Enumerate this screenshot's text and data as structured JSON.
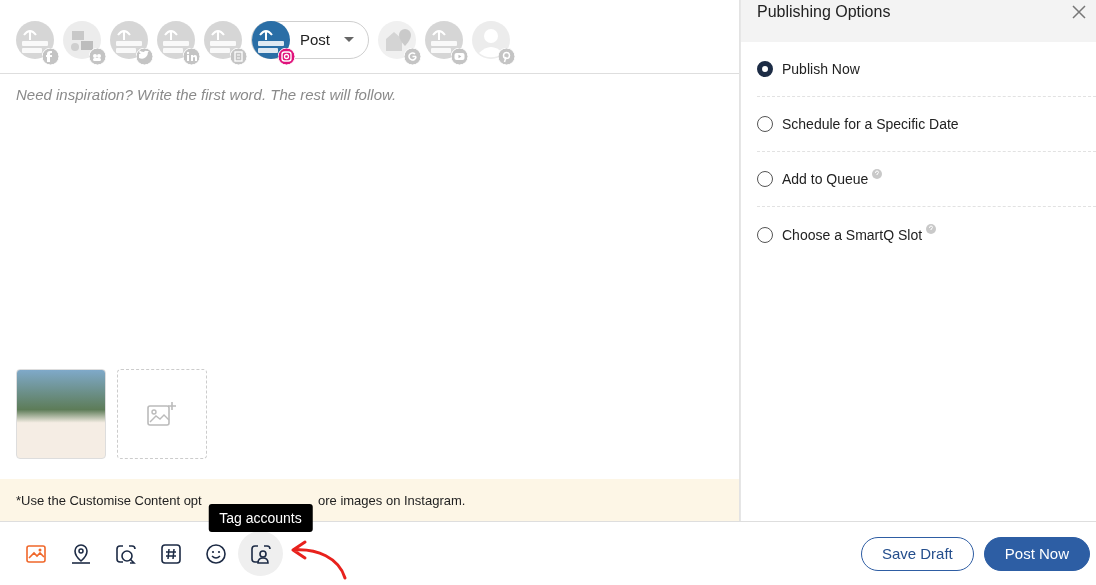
{
  "accounts": [
    {
      "kind": "logo",
      "badge": {
        "kind": "facebook"
      },
      "selected": false
    },
    {
      "kind": "illustration",
      "badge": {
        "kind": "group"
      },
      "selected": false
    },
    {
      "kind": "logo",
      "badge": {
        "kind": "twitter"
      },
      "selected": false
    },
    {
      "kind": "logo",
      "badge": {
        "kind": "linkedin"
      },
      "selected": false
    },
    {
      "kind": "logo",
      "badge": {
        "kind": "book"
      },
      "selected": false
    },
    {
      "kind": "logo",
      "badge": {
        "kind": "instagram"
      },
      "selected": true,
      "post_type": "Post"
    },
    {
      "kind": "store",
      "badge": {
        "kind": "google"
      },
      "selected": false
    },
    {
      "kind": "logo",
      "badge": {
        "kind": "youtube"
      },
      "selected": false
    },
    {
      "kind": "person",
      "badge": {
        "kind": "pinterest"
      },
      "selected": false
    }
  ],
  "composer": {
    "placeholder": "Need inspiration? Write the first word. The rest will follow."
  },
  "media": [
    {
      "kind": "image"
    },
    {
      "kind": "add"
    }
  ],
  "notice": [
    "*Use the Customise Content opt",
    "ore images on Instagram."
  ],
  "toolbar": [
    {
      "kind": "image",
      "selected": true,
      "hovered": false
    },
    {
      "kind": "location",
      "selected": false,
      "hovered": false
    },
    {
      "kind": "mention",
      "selected": false,
      "hovered": false
    },
    {
      "kind": "hashtag",
      "selected": false,
      "hovered": false
    },
    {
      "kind": "emoji",
      "selected": false,
      "hovered": false
    },
    {
      "kind": "tag",
      "selected": false,
      "hovered": true,
      "tooltip": "Tag accounts"
    }
  ],
  "actions": [
    {
      "label": "Save Draft",
      "kind": "secondary"
    },
    {
      "label": "Post Now",
      "kind": "primary"
    }
  ],
  "publishing": {
    "title": "Publishing Options",
    "options": [
      {
        "label": "Publish Now",
        "selected": true,
        "help": false
      },
      {
        "label": "Schedule for a Specific Date",
        "selected": false,
        "help": false
      },
      {
        "label": "Add to Queue",
        "selected": false,
        "help": true
      },
      {
        "label": "Choose a SmartQ Slot",
        "selected": false,
        "help": true
      }
    ]
  }
}
